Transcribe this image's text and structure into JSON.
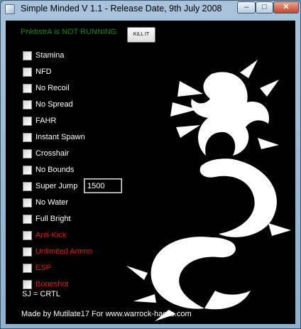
{
  "window": {
    "title": "Simple Minded V 1.1  - Release Date, 9th July 2008",
    "controls": {
      "minimize": "–",
      "maximize": "□",
      "close": "✕"
    }
  },
  "status": {
    "text": "PnkbstrA is NOT RUNNING",
    "color": "#0a8a0a"
  },
  "kill_button": {
    "label": "KILL IT"
  },
  "options": [
    {
      "label": "Stamina",
      "checked": false
    },
    {
      "label": "NFD",
      "checked": false
    },
    {
      "label": "No Recoil",
      "checked": false
    },
    {
      "label": "No Spread",
      "checked": false
    },
    {
      "label": "FAHR",
      "checked": false
    },
    {
      "label": "Instant Spawn",
      "checked": false
    },
    {
      "label": "Crosshair",
      "checked": false
    },
    {
      "label": "No Bounds",
      "checked": false
    },
    {
      "label": "Super Jump",
      "checked": false
    },
    {
      "label": "No Water",
      "checked": false
    },
    {
      "label": "Full Bright",
      "checked": false
    },
    {
      "label": "Anti-Kick",
      "checked": false
    },
    {
      "label": "Unlimited Ammo",
      "checked": false
    },
    {
      "label": "ESP",
      "checked": false
    },
    {
      "label": "Boneshot",
      "checked": false
    }
  ],
  "super_jump_value": "1500",
  "hotkey_note": "SJ = CRTL",
  "credit": "Made by Mutilate17 For www.warrock-hacks.com",
  "colors": {
    "background": "#000000",
    "text": "#ffffff",
    "warning": "#e01818",
    "status_ok": "#0a8a0a"
  },
  "icons": {
    "app": "app-icon",
    "artwork": "tribal-dragon-icon"
  }
}
